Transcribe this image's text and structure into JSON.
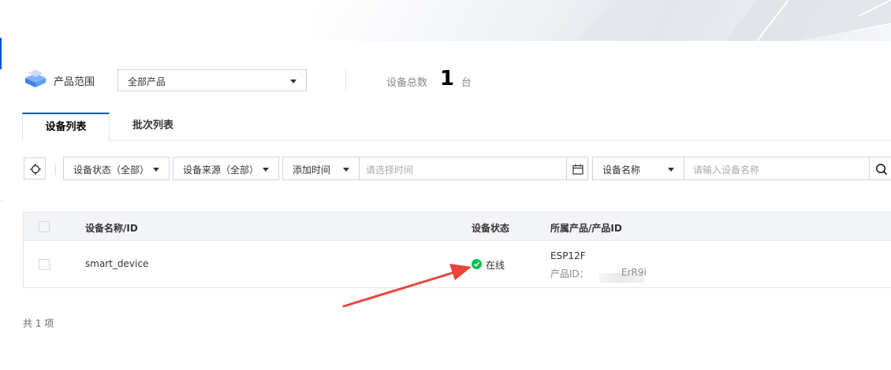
{
  "range": {
    "label": "产品范围",
    "select_value": "全部产品",
    "total_label": "设备总数",
    "total_count": "1",
    "total_unit": "台",
    "icon": "product-cube-icon"
  },
  "tabs": [
    {
      "label": "设备列表",
      "active": true
    },
    {
      "label": "批次列表",
      "active": false
    }
  ],
  "filters": {
    "status": "设备状态（全部）",
    "source": "设备来源（全部）",
    "time_type": "添加时间",
    "time_placeholder": "请选择时间",
    "name_type": "设备名称",
    "name_placeholder": "请输入设备名称"
  },
  "table": {
    "columns": [
      "设备名称/ID",
      "设备状态",
      "所属产品/产品ID"
    ],
    "rows": [
      {
        "name": "smart_device",
        "status": "在线",
        "status_color": "#0abf5b",
        "product": "ESP12F",
        "product_id_label": "产品ID：",
        "product_id_visible": "ErR9i"
      }
    ]
  },
  "footer": {
    "total_text": "共 1 项"
  },
  "colors": {
    "accent": "#0052d9",
    "arrow": "#e8453c",
    "online": "#0abf5b"
  }
}
